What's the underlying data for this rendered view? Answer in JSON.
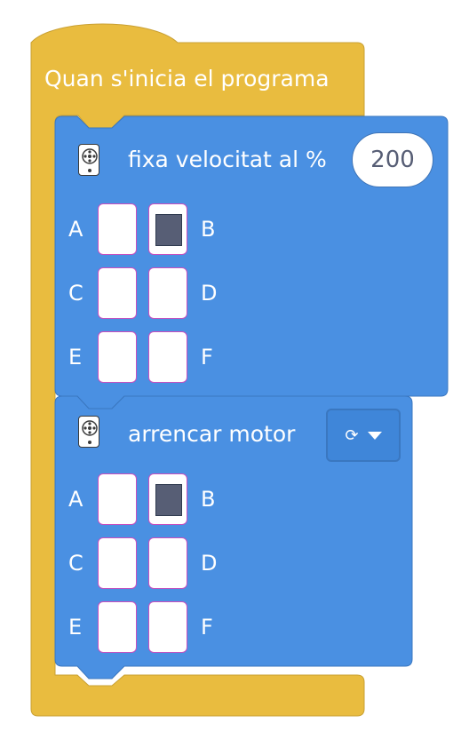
{
  "hat_block": {
    "label": "Quan s'inicia el programa",
    "color": "#e9bc3f"
  },
  "block_speed": {
    "label": "fixa velocitat al %",
    "value": "200",
    "color": "#4a90e2",
    "icon": "motor-icon",
    "ports": [
      {
        "left": "A",
        "right": "B",
        "left_selected": false,
        "right_selected": true
      },
      {
        "left": "C",
        "right": "D",
        "left_selected": false,
        "right_selected": false
      },
      {
        "left": "E",
        "right": "F",
        "left_selected": false,
        "right_selected": false
      }
    ]
  },
  "block_start": {
    "label": "arrencar motor",
    "dropdown_icon": "rotate-icon",
    "color": "#4a90e2",
    "icon": "motor-icon",
    "ports": [
      {
        "left": "A",
        "right": "B",
        "left_selected": false,
        "right_selected": true
      },
      {
        "left": "C",
        "right": "D",
        "left_selected": false,
        "right_selected": false
      },
      {
        "left": "E",
        "right": "F",
        "left_selected": false,
        "right_selected": false
      }
    ]
  }
}
